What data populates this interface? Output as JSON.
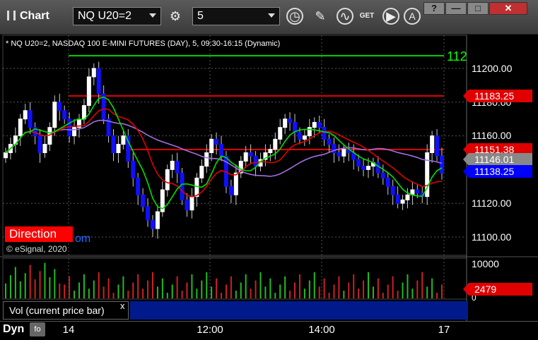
{
  "toolbar": {
    "app_title": "Chart",
    "symbol": "NQ U20=2",
    "interval": "5",
    "get_label": "GET",
    "win_help": "?",
    "win_min": "—",
    "win_max": "□",
    "win_close": "✕"
  },
  "chart": {
    "header": "* NQ U20=2, NASDAQ 100 E-MINI FUTURES (DAY), 5, 09:30-16:15 (Dynamic)",
    "direction_label": "Direction",
    "direction_tail": "om",
    "copyright": "© eSignal, 2020",
    "top_line_label": "112",
    "y_ticks": [
      "11200.00",
      "11180.00",
      "11160.00",
      "11120.00",
      "11100.00"
    ],
    "tags": [
      {
        "text": "11183.25",
        "color": "#e00000"
      },
      {
        "text": "11151.38",
        "color": "#e00000"
      },
      {
        "text": "11146.01",
        "color": "#888888"
      },
      {
        "text": "11138.25",
        "color": "#0000ff"
      }
    ],
    "x_ticks": [
      "14",
      "12:00",
      "14:00",
      "17"
    ]
  },
  "volume": {
    "label": "Vol (current price bar)",
    "close": "x",
    "y_ticks": [
      "10000",
      "0"
    ],
    "tag": "2479"
  },
  "bottom": {
    "dyn_label": "Dyn",
    "dyn_icon": "fo"
  },
  "chart_data": {
    "type": "candlestick",
    "title": "* NQ U20=2, NASDAQ 100 E-MINI FUTURES (DAY), 5, 09:30-16:15 (Dynamic)",
    "ylim": [
      11094,
      11220
    ],
    "x_ticks": [
      "14",
      "12:00",
      "14:00",
      "17"
    ],
    "levels": [
      {
        "value": 11207,
        "color": "#00cc00"
      },
      {
        "value": 11183.25,
        "color": "#e00000"
      },
      {
        "value": 11151.38,
        "color": "#e00000"
      }
    ],
    "candles_close": [
      11150,
      11155,
      11160,
      11170,
      11175,
      11165,
      11160,
      11150,
      11155,
      11165,
      11180,
      11175,
      11170,
      11160,
      11165,
      11170,
      11178,
      11195,
      11200,
      11185,
      11170,
      11160,
      11150,
      11155,
      11160,
      11145,
      11135,
      11125,
      11118,
      11110,
      11105,
      11115,
      11128,
      11140,
      11145,
      11138,
      11122,
      11116,
      11124,
      11135,
      11142,
      11150,
      11158,
      11155,
      11148,
      11130,
      11125,
      11138,
      11145,
      11150,
      11148,
      11142,
      11146,
      11150,
      11152,
      11158,
      11165,
      11170,
      11168,
      11162,
      11158,
      11160,
      11165,
      11168,
      11165,
      11158,
      11155,
      11150,
      11148,
      11152,
      11150,
      11146,
      11142,
      11140,
      11142,
      11144,
      11138,
      11135,
      11130,
      11125,
      11120,
      11122,
      11125,
      11128,
      11126,
      11124,
      11150,
      11160,
      11148,
      11138
    ],
    "series": [
      {
        "name": "",
        "color": "#a070e0"
      },
      {
        "name": "",
        "color": "#e00000"
      },
      {
        "name": "",
        "color": "#00e000"
      }
    ],
    "volume_ylim": [
      0,
      10000
    ],
    "volume_last": 2479
  }
}
